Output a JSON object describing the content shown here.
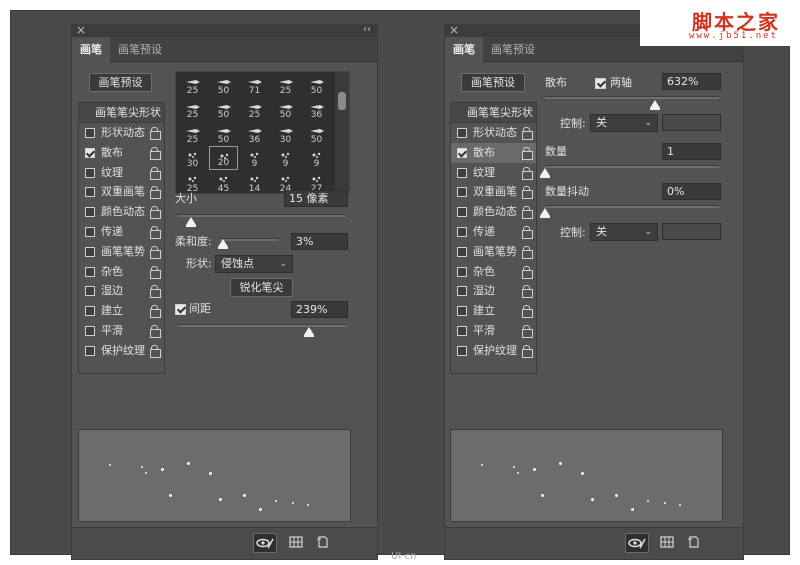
{
  "watermark": {
    "brand": "脚本之家",
    "url": "www.jb51.net",
    "logo": "UI·cn"
  },
  "left": {
    "tabs": [
      {
        "label": "画笔",
        "active": true
      },
      {
        "label": "画笔预设",
        "active": false
      }
    ],
    "preset_button": "画笔预设",
    "sidebar": {
      "header": "画笔笔尖形状",
      "items": [
        {
          "label": "形状动态",
          "checked": false
        },
        {
          "label": "散布",
          "checked": true
        },
        {
          "label": "纹理",
          "checked": false
        },
        {
          "label": "双重画笔",
          "checked": false
        },
        {
          "label": "颜色动态",
          "checked": false
        },
        {
          "label": "传递",
          "checked": false
        },
        {
          "label": "画笔笔势",
          "checked": false
        },
        {
          "label": "杂色",
          "checked": false
        },
        {
          "label": "湿边",
          "checked": false
        },
        {
          "label": "建立",
          "checked": false
        },
        {
          "label": "平滑",
          "checked": false
        },
        {
          "label": "保护纹理",
          "checked": false
        }
      ]
    },
    "brush_sizes": [
      "25",
      "50",
      "71",
      "25",
      "50",
      "25",
      "50",
      "25",
      "50",
      "36",
      "25",
      "50",
      "36",
      "30",
      "50",
      "30",
      "20",
      "9",
      "9",
      "9",
      "25",
      "45",
      "14",
      "24",
      "27"
    ],
    "size": {
      "label": "大小",
      "value": "15 像素",
      "level": 0.08
    },
    "hardness": {
      "label": "柔和度:",
      "value": "3%",
      "level": 0.05
    },
    "shape": {
      "label": "形状:",
      "value": "侵蚀点"
    },
    "sharpen_button": "锐化笔尖",
    "spacing": {
      "label": "间距",
      "value": "239%",
      "checked": true,
      "level": 0.78
    }
  },
  "right": {
    "tabs": [
      {
        "label": "画笔",
        "active": true
      },
      {
        "label": "画笔预设",
        "active": false
      }
    ],
    "preset_button": "画笔预设",
    "sidebar": {
      "header": "画笔笔尖形状",
      "items": [
        {
          "label": "形状动态",
          "checked": false
        },
        {
          "label": "散布",
          "checked": true,
          "selected": true
        },
        {
          "label": "纹理",
          "checked": false
        },
        {
          "label": "双重画笔",
          "checked": false
        },
        {
          "label": "颜色动态",
          "checked": false
        },
        {
          "label": "传递",
          "checked": false
        },
        {
          "label": "画笔笔势",
          "checked": false
        },
        {
          "label": "杂色",
          "checked": false
        },
        {
          "label": "湿边",
          "checked": false
        },
        {
          "label": "建立",
          "checked": false
        },
        {
          "label": "平滑",
          "checked": false
        },
        {
          "label": "保护纹理",
          "checked": false
        }
      ]
    },
    "scatter": {
      "label": "散布",
      "both_axes_label": "两轴",
      "both_axes": true,
      "value": "632%",
      "level": 0.63
    },
    "control1": {
      "label": "控制:",
      "value": "关"
    },
    "count": {
      "label": "数量",
      "value": "1",
      "level": 0.0
    },
    "count_jitter": {
      "label": "数量抖动",
      "value": "0%",
      "level": 0.0
    },
    "control2": {
      "label": "控制:",
      "value": "关"
    }
  },
  "icons": {
    "footer": [
      "eye-brush-icon",
      "grid-icon",
      "new-page-icon"
    ]
  },
  "colors": {
    "panel": "#535353",
    "frame": "#4a4a4a",
    "preview": "#6c6c6c",
    "watermark": "#d0331f"
  }
}
